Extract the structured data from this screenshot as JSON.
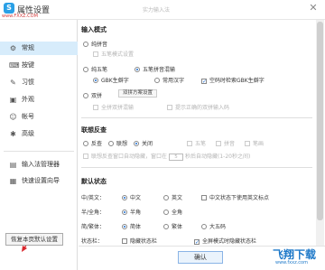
{
  "window": {
    "app_title": "属性设置",
    "app_logo_glyph": "S",
    "center_title": "实力输入法",
    "close_glyph": "✕",
    "watermark_top": "www.FXXZ.COM"
  },
  "sidebar": {
    "items": [
      {
        "label": "常规",
        "icon": "gear-icon",
        "glyph": "⚙",
        "active": true
      },
      {
        "label": "按键",
        "icon": "keyboard-icon",
        "glyph": "⌨",
        "active": false
      },
      {
        "label": "习惯",
        "icon": "habit-icon",
        "glyph": "✎",
        "active": false
      },
      {
        "label": "外观",
        "icon": "skin-icon",
        "glyph": "▣",
        "active": false
      },
      {
        "label": "帐号",
        "icon": "user-icon",
        "glyph": "☺",
        "active": false
      },
      {
        "label": "高级",
        "icon": "advanced-icon",
        "glyph": "✱",
        "active": false
      }
    ],
    "tools": [
      {
        "label": "输入法管理器",
        "icon": "manager-icon",
        "glyph": "▤"
      },
      {
        "label": "快速设置向导",
        "icon": "wizard-icon",
        "glyph": "▦"
      }
    ],
    "restore_label": "恢复本页默认设置"
  },
  "sections": {
    "input_mode": {
      "title": "输入模式",
      "pinyin": "纯拼音",
      "pinyin_sub": "五笔模式设置",
      "wubi": "纯五笔",
      "wubi_pinyin": "五笔拼音混输",
      "gbk_chars": "GBK生僻字",
      "common_chars": "常用汉字",
      "gbk_check": "空码时检索GBK生僻字",
      "shuangpin": "双拼",
      "shuangpin_btn": "双拼方案设置",
      "fuzzy": "全拼双拼混输",
      "hint": "提示正确的双拼输入码"
    },
    "association": {
      "title": "联想反查",
      "reverse": "反查",
      "associate": "联想",
      "off": "关闭",
      "opt_a": "五笔",
      "opt_b": "拼音",
      "opt_c": "笔画",
      "window_text_1": "联想反查窗口自动隐藏，窗口在",
      "window_seconds": "5",
      "window_text_2": "秒后自动隐藏(1-20秒之间)"
    },
    "default_state": {
      "title": "默认状态",
      "row_zh_en": "中/英文：",
      "zh": "中文",
      "en": "英文",
      "zh_en_extra": "中文状态下使用英文标点",
      "row_width": "半/全角：",
      "half": "半角",
      "full": "全角",
      "row_trad": "简/繁体：",
      "simplified": "简体",
      "traditional": "繁体",
      "big5": "大五码",
      "row_status": "状态栏：",
      "hide_status": "隐藏状态栏",
      "fullscreen_hide": "全屏模式时隐藏状态栏"
    }
  },
  "footer": {
    "ok_label": "确认",
    "watermark_logo": "飞翔下载",
    "watermark_url": "www.fxxz.com"
  },
  "colors": {
    "accent": "#1f6fd1",
    "sidebar_active": "#d7ecfb",
    "annotation_red": "#d9262c"
  }
}
